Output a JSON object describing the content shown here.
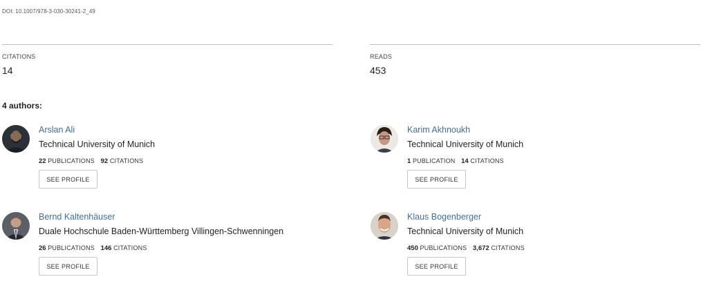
{
  "header": {
    "doi": "DOI: 10.1007/978-3-030-30241-2_49"
  },
  "stats": {
    "citations_label": "CITATIONS",
    "citations_value": "14",
    "reads_label": "READS",
    "reads_value": "453"
  },
  "authors_heading": "4 authors:",
  "authors": [
    {
      "name": "Arslan Ali",
      "institution": "Technical University of Munich",
      "publications": "22",
      "publications_unit": "PUBLICATIONS",
      "citations": "92",
      "citations_unit": "CITATIONS",
      "button": "SEE PROFILE",
      "avatar_bg": "#2b3138"
    },
    {
      "name": "Karim Akhnoukh",
      "institution": "Technical University of Munich",
      "publications": "1",
      "publications_unit": "PUBLICATION",
      "citations": "14",
      "citations_unit": "CITATIONS",
      "button": "SEE PROFILE",
      "avatar_bg": "#e9e4df"
    },
    {
      "name": "Bernd Kaltenhäuser",
      "institution": "Duale Hochschule Baden-Württemberg Villingen-Schwenningen",
      "publications": "26",
      "publications_unit": "PUBLICATIONS",
      "citations": "146",
      "citations_unit": "CITATIONS",
      "button": "SEE PROFILE",
      "avatar_bg": "#5b6068"
    },
    {
      "name": "Klaus Bogenberger",
      "institution": "Technical University of Munich",
      "publications": "450",
      "publications_unit": "PUBLICATIONS",
      "citations": "3,672",
      "citations_unit": "CITATIONS",
      "button": "SEE PROFILE",
      "avatar_bg": "#d8d2c8"
    }
  ]
}
